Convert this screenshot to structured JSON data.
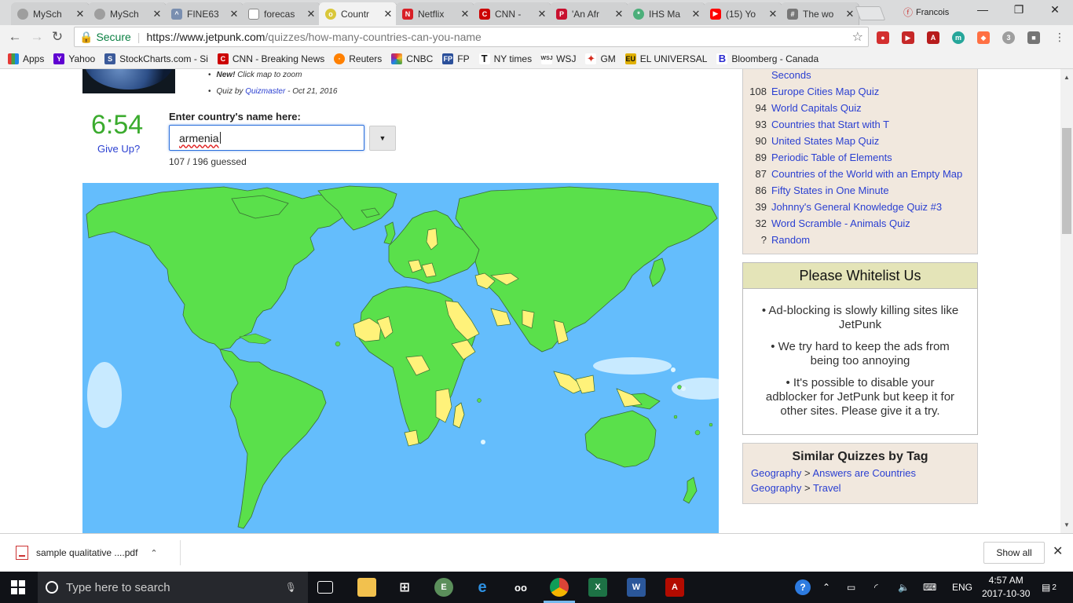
{
  "tabs": [
    {
      "title": "MySch",
      "color": "#9e9e9e",
      "glyph": ""
    },
    {
      "title": "MySch",
      "color": "#9e9e9e",
      "glyph": ""
    },
    {
      "title": "FINE63",
      "color": "#7a8fb0",
      "glyph": "^"
    },
    {
      "title": "forecas",
      "color": "#ffffff",
      "glyph": ""
    },
    {
      "title": "Countr",
      "color": "#d9c73a",
      "glyph": "o"
    },
    {
      "title": "Netflix",
      "color": "#d81f26",
      "glyph": "N"
    },
    {
      "title": "CNN -",
      "color": "#cc0000",
      "glyph": "C"
    },
    {
      "title": "'An Afr",
      "color": "#c8102e",
      "glyph": "P"
    },
    {
      "title": "IHS Ma",
      "color": "#4caf7a",
      "glyph": "*"
    },
    {
      "title": "(15) Yo",
      "color": "#ff0000",
      "glyph": "▶"
    },
    {
      "title": "The wo",
      "color": "#777777",
      "glyph": "#"
    }
  ],
  "profile": {
    "name": "Francois"
  },
  "address": {
    "secure_label": "Secure",
    "host": "https://www.jetpunk.com",
    "path": "/quizzes/how-many-countries-can-you-name"
  },
  "bookmarks": [
    {
      "label": "Apps",
      "icon": "apps-icon",
      "color": "#e53935"
    },
    {
      "label": "Yahoo",
      "icon": "yahoo-icon",
      "color": "#5f01d1"
    },
    {
      "label": "StockCharts.com - Si",
      "icon": "stockcharts-icon",
      "color": "#3b5a9a"
    },
    {
      "label": "CNN - Breaking News",
      "icon": "cnn-icon",
      "color": "#cc0000"
    },
    {
      "label": "Reuters",
      "icon": "reuters-icon",
      "color": "#ff8000"
    },
    {
      "label": "CNBC",
      "icon": "cnbc-icon",
      "color": "#2f6fc8"
    },
    {
      "label": "FP",
      "icon": "fp-icon",
      "color": "#2a4f9a"
    },
    {
      "label": "NY times",
      "icon": "nytimes-icon",
      "color": "#111111"
    },
    {
      "label": "WSJ",
      "icon": "wsj-icon",
      "color": "#333333"
    },
    {
      "label": "GM",
      "icon": "maple-leaf-icon",
      "color": "#d52b1e"
    },
    {
      "label": "EL UNIVERSAL",
      "icon": "eluniversal-icon",
      "color": "#e0b000"
    },
    {
      "label": "Bloomberg - Canada",
      "icon": "bloomberg-icon",
      "color": "#2a2ad0"
    }
  ],
  "quiz": {
    "new_label": "New!",
    "new_text": "Click map to zoom",
    "by_prefix": "Quiz by",
    "author": "Quizmaster",
    "date": "- Oct 21, 2016",
    "timer": "6:54",
    "give_up": "Give Up?",
    "input_label": "Enter country's name here:",
    "input_value": "armenia",
    "guessed": "107 / 196 guessed"
  },
  "popular": [
    {
      "count": "",
      "title": "Seconds"
    },
    {
      "count": "108",
      "title": "Europe Cities Map Quiz"
    },
    {
      "count": "94",
      "title": "World Capitals Quiz"
    },
    {
      "count": "93",
      "title": "Countries that Start with T"
    },
    {
      "count": "90",
      "title": "United States Map Quiz"
    },
    {
      "count": "89",
      "title": "Periodic Table of Elements"
    },
    {
      "count": "87",
      "title": "Countries of the World with an Empty Map"
    },
    {
      "count": "86",
      "title": "Fifty States in One Minute"
    },
    {
      "count": "39",
      "title": "Johnny's General Knowledge Quiz #3"
    },
    {
      "count": "32",
      "title": "Word Scramble - Animals Quiz"
    },
    {
      "count": "?",
      "title": "Random"
    }
  ],
  "whitelist": {
    "title": "Please Whitelist Us",
    "p1": "• Ad-blocking is slowly killing sites like JetPunk",
    "p2": "• We try hard to keep the ads from being too annoying",
    "p3": "• It's possible to disable your adblocker for JetPunk but keep it for other sites. Please give it a try."
  },
  "similar": {
    "title": "Similar Quizzes by Tag",
    "rows": [
      {
        "tag": "Geography",
        "sep": ">",
        "sub": "Answers are Countries"
      },
      {
        "tag": "Geography",
        "sep": ">",
        "sub": "Travel"
      }
    ]
  },
  "downloads": {
    "file": "sample qualitative ....pdf",
    "show_all": "Show all"
  },
  "taskbar": {
    "search_placeholder": "Type here to search",
    "language": "ENG",
    "time": "4:57 AM",
    "date": "2017-10-30",
    "notifications": "2"
  },
  "colors": {
    "guessed_country": "#5ae04b",
    "unguessed_country": "#fff27a",
    "ocean": "#64bdfc",
    "timer": "#3bab2e",
    "link": "#2a3fd1"
  }
}
